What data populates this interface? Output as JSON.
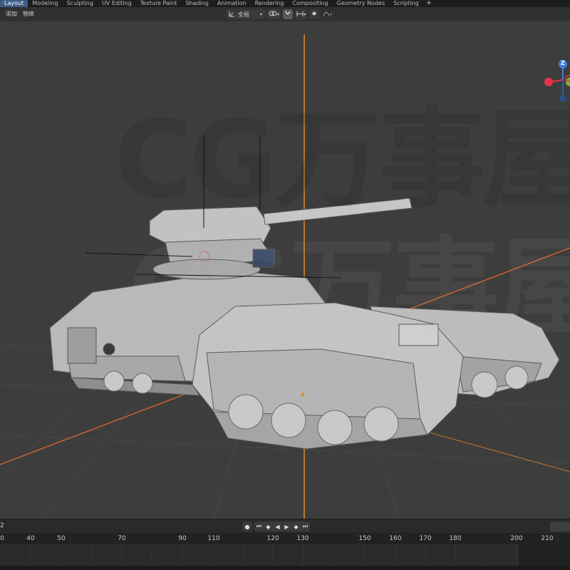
{
  "workspace_tabs": [
    {
      "label": "Layout",
      "active": true
    },
    {
      "label": "Modeling",
      "active": false
    },
    {
      "label": "Sculpting",
      "active": false
    },
    {
      "label": "UV Editing",
      "active": false
    },
    {
      "label": "Texture Paint",
      "active": false
    },
    {
      "label": "Shading",
      "active": false
    },
    {
      "label": "Animation",
      "active": false
    },
    {
      "label": "Rendering",
      "active": false
    },
    {
      "label": "Compositing",
      "active": false
    },
    {
      "label": "Geometry Nodes",
      "active": false
    },
    {
      "label": "Scripting",
      "active": false
    }
  ],
  "add_workspace_label": "+",
  "viewport_header": {
    "menus": [
      "添加",
      "物体"
    ],
    "orientation": {
      "icon": "transform-orientation-icon",
      "value": "全局"
    },
    "snap_icons": [
      "pivot-icon",
      "snap-icon",
      "snap-increment-icon",
      "proportional-edit-icon",
      "falloff-icon"
    ]
  },
  "watermark_text": "CG万事屋",
  "gizmo": {
    "axis_label": "Z"
  },
  "timeline": {
    "current_frame_left": "2",
    "playback_buttons": [
      "record-icon",
      "jump-start-icon",
      "prev-keyframe-icon",
      "play-icon",
      "next-keyframe-icon",
      "jump-end-icon"
    ],
    "ruler_ticks": [
      "0",
      "40",
      "50",
      "70",
      "90",
      "110",
      "120",
      "130",
      "150",
      "160",
      "170",
      "180",
      "200",
      "210"
    ]
  },
  "colors": {
    "active_tab": "#3d5c8a",
    "viewport_bg": "#3d3d3d",
    "x_axis": "#e06a2a",
    "z_axis": "#d98a2b",
    "gizmo_x": "#e3344b",
    "gizmo_y": "#7fb23b",
    "gizmo_z": "#3d7fe0"
  }
}
